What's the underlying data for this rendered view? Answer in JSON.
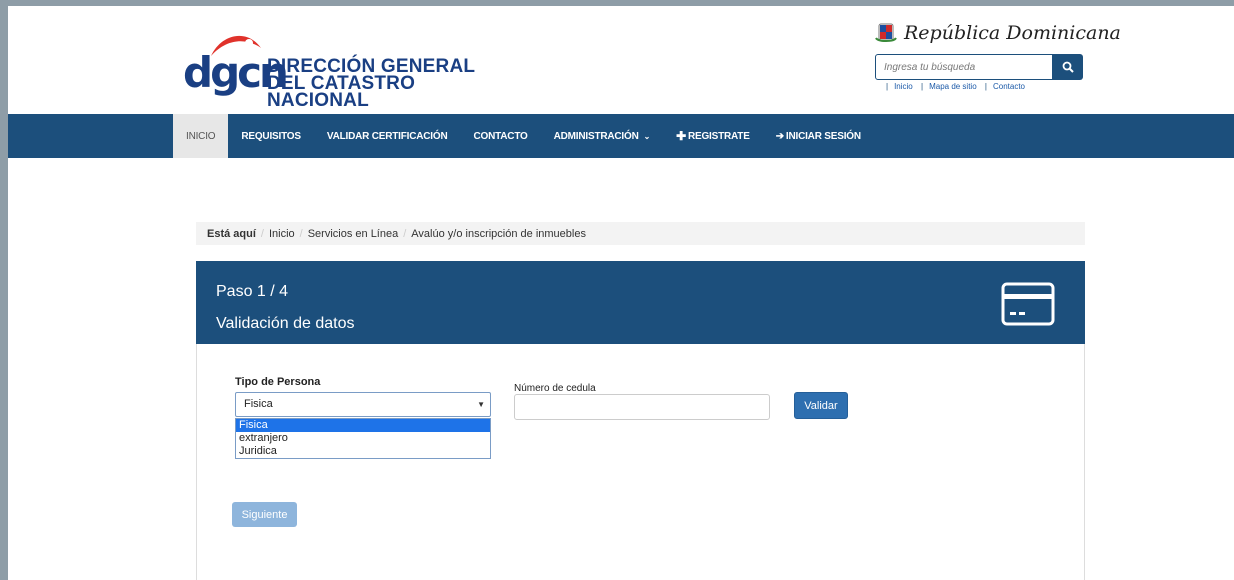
{
  "header": {
    "logo_mark": "dgcn",
    "logo_line1": "DIRECCIÓN GENERAL",
    "logo_line2": "DEL CATASTRO NACIONAL",
    "country": "República Dominicana"
  },
  "search": {
    "placeholder": "Ingresa tu búsqueda",
    "icon": "search-icon"
  },
  "top_links": [
    "Inicio",
    "Mapa de sitio",
    "Contacto"
  ],
  "nav": [
    {
      "label": "INICIO"
    },
    {
      "label": "REQUISITOS"
    },
    {
      "label": "VALIDAR CERTIFICACIÓN"
    },
    {
      "label": "CONTACTO"
    },
    {
      "label": "ADMINISTRACIÓN"
    },
    {
      "label": "REGISTRATE"
    },
    {
      "label": "INICIAR SESIÓN"
    }
  ],
  "breadcrumb": {
    "prefix": "Está aquí",
    "items": [
      "Inicio",
      "Servicios en Línea",
      "Avalúo y/o inscripción de inmuebles"
    ]
  },
  "panel": {
    "step": "Paso 1 / 4",
    "title": "Validación de datos",
    "icon": "credit-card-icon"
  },
  "form": {
    "tipo_label": "Tipo de Persona",
    "tipo_selected": "Fisica",
    "tipo_options": [
      "Fisica",
      "extranjero",
      "Juridica"
    ],
    "cedula_label": "Número de cedula",
    "cedula_value": "",
    "validar_label": "Validar",
    "siguiente_label": "Siguiente"
  },
  "colors": {
    "primary": "#1c4f7c",
    "button": "#2e6fb0",
    "button_disabled": "#8eb5dc",
    "option_highlight": "#1e73e8"
  }
}
